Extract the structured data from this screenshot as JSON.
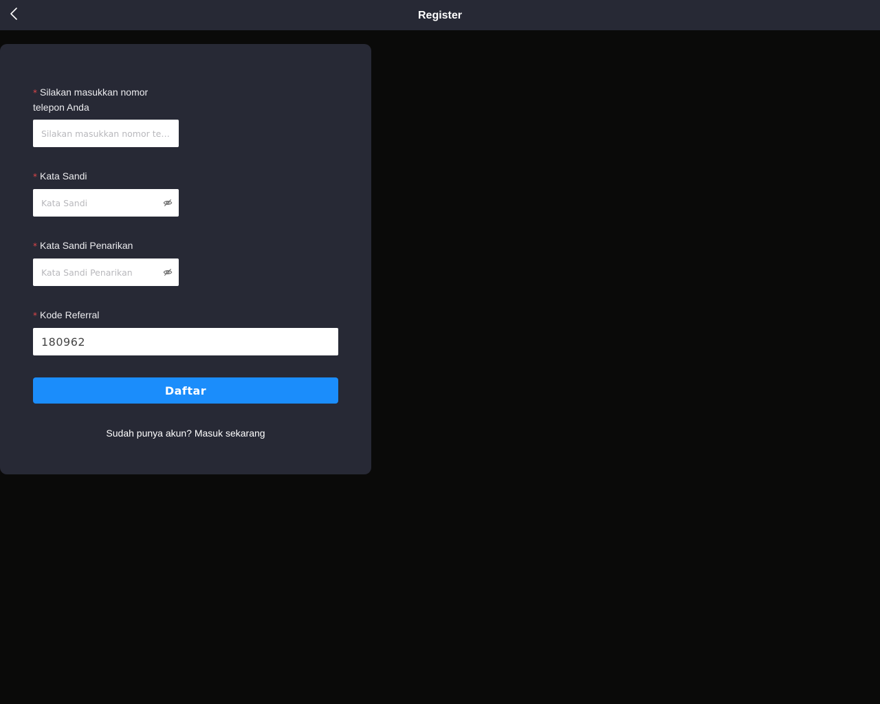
{
  "header": {
    "title": "Register",
    "back_icon": "chevron-left-icon"
  },
  "form": {
    "required_mark": "*",
    "phone": {
      "label": "Silakan masukkan nomor telepon Anda",
      "placeholder": "Silakan masukkan nomor telepon Anda",
      "value": ""
    },
    "password": {
      "label": "Kata Sandi",
      "placeholder": "Kata Sandi",
      "value": "",
      "toggle_icon": "eye-off-icon"
    },
    "withdraw_password": {
      "label": "Kata Sandi Penarikan",
      "placeholder": "Kata Sandi Penarikan",
      "value": "",
      "toggle_icon": "eye-off-icon"
    },
    "referral": {
      "label": "Kode Referral",
      "value": "180962"
    },
    "submit_label": "Daftar",
    "login_prompt": "Sudah punya akun? Masuk sekarang"
  },
  "colors": {
    "background": "#0a0a09",
    "panel": "#272935",
    "primary": "#1b8dfb",
    "required": "#e0474a"
  }
}
